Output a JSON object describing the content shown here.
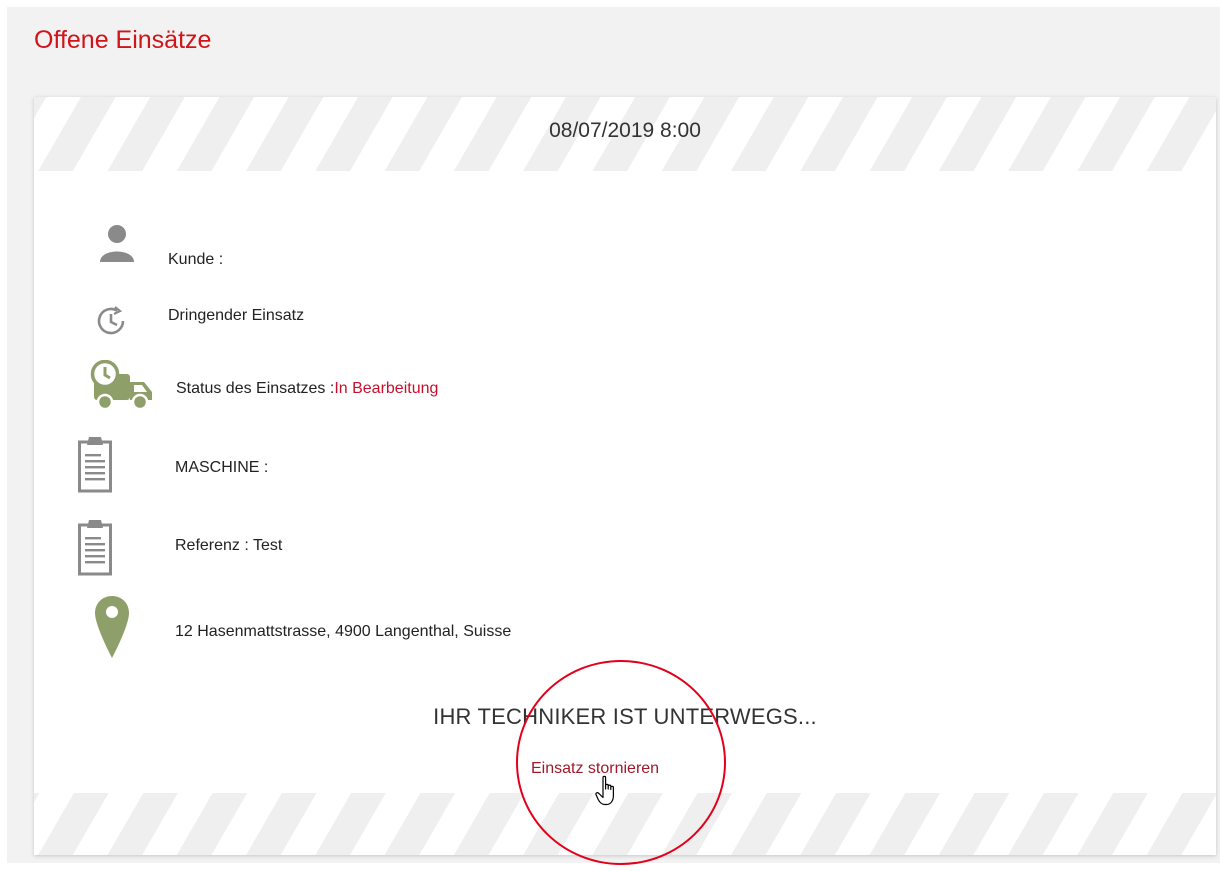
{
  "page": {
    "title": "Offene Einsätze"
  },
  "intervention": {
    "datetime": "08/07/2019 8:00",
    "customer_label": "Kunde :",
    "urgency_label": "Dringender Einsatz",
    "status_label": "Status des Einsatzes :",
    "status_value": "In Bearbeitung",
    "machine_label": "MASCHINE :",
    "reference_label": "Referenz : Test",
    "address": "12 Hasenmattstrasse, 4900 Langenthal, Suisse",
    "arrival_note": "IHR TECHNIKER IST UNTERWEGS...",
    "cancel_label": "Einsatz stornieren"
  },
  "icons": {
    "customer": "person-icon",
    "urgency": "clock-icon",
    "status": "delivery-truck-icon",
    "machine": "clipboard-icon",
    "reference": "clipboard-icon",
    "address": "map-pin-icon",
    "cursor": "hand-pointer-icon"
  },
  "colors": {
    "brand_red": "#d0141a",
    "status_red": "#c8102e",
    "icon_green": "#8f9f6a",
    "icon_gray": "#8a8a8a",
    "highlight_red": "#e3001b"
  }
}
